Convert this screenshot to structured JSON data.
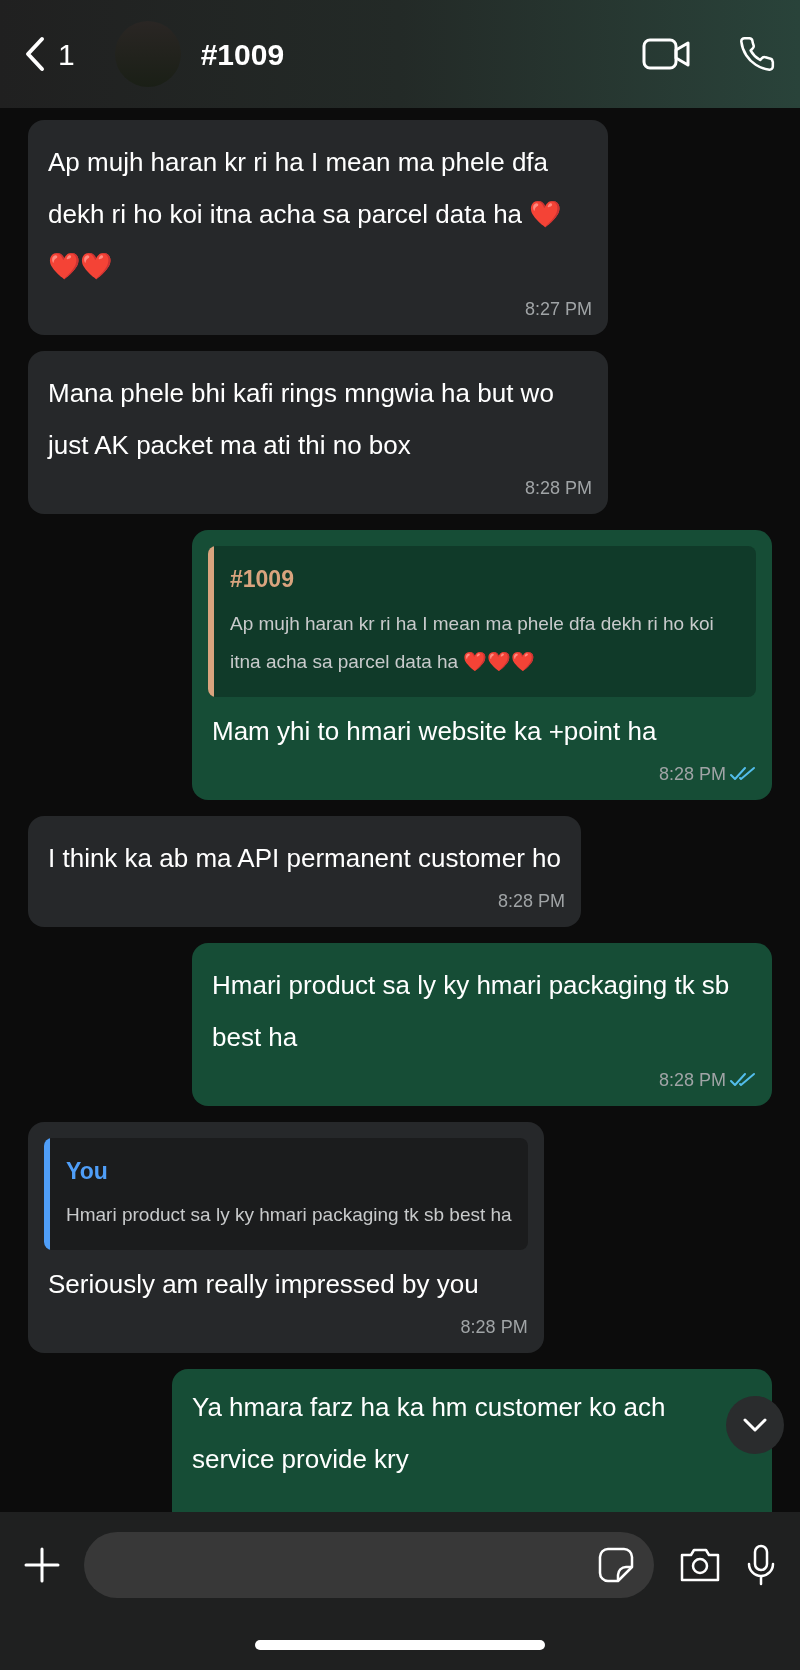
{
  "header": {
    "back_count": "1",
    "title": "#1009"
  },
  "messages": [
    {
      "kind": "incoming",
      "text": "Ap mujh haran kr ri ha I mean ma phele dfa dekh ri ho koi itna acha sa parcel data ha ❤️❤️❤️",
      "time": "8:27 PM"
    },
    {
      "kind": "incoming",
      "text": "Mana phele bhi kafi rings mngwia ha but wo just AK packet ma ati thi no box",
      "time": "8:28 PM"
    },
    {
      "kind": "outgoing",
      "quote": {
        "author": "#1009",
        "text": "Ap mujh haran kr ri ha I mean ma phele dfa dekh ri ho koi itna acha sa parcel data ha ❤️❤️❤️"
      },
      "text": "Mam yhi to hmari website ka +point ha",
      "time": "8:28 PM",
      "read": true
    },
    {
      "kind": "incoming",
      "text": "I think ka ab ma API permanent customer ho",
      "time": "8:28 PM"
    },
    {
      "kind": "outgoing",
      "text": "Hmari product sa ly ky hmari packaging tk sb best ha",
      "time": "8:28 PM",
      "read": true
    },
    {
      "kind": "incoming",
      "quote": {
        "author": "You",
        "text": "Hmari product sa ly ky hmari packaging tk sb best ha"
      },
      "text": "Seriously am really impressed by you",
      "time": "8:28 PM"
    },
    {
      "kind": "outgoing",
      "lines": [
        "Ya hmara farz ha ka hm customer ko ach",
        "service provide kry"
      ]
    }
  ]
}
